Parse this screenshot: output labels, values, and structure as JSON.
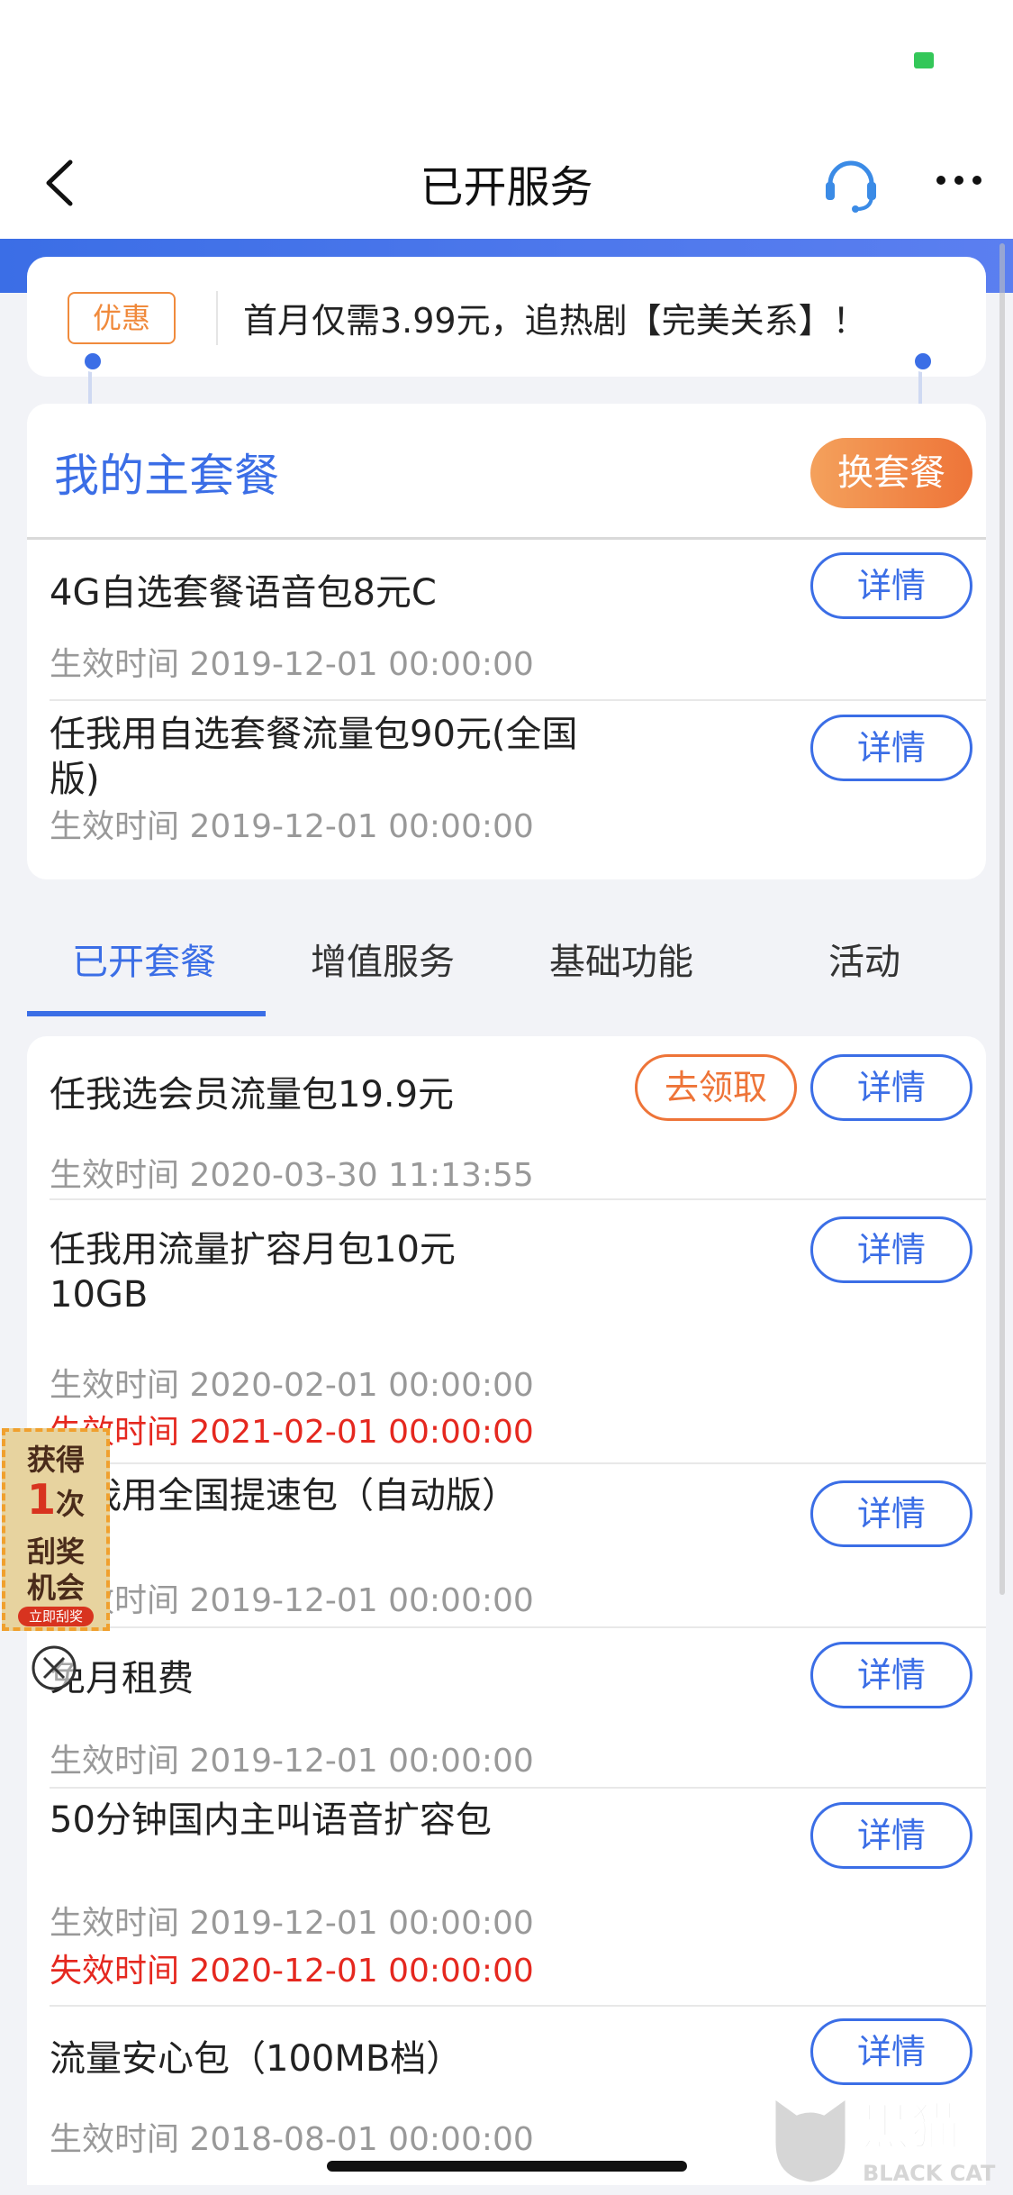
{
  "nav": {
    "title": "已开服务"
  },
  "promo": {
    "tag": "优惠",
    "text": "首月仅需3.99元，追热剧【完美关系】！"
  },
  "main_package": {
    "title": "我的主套餐",
    "switch_label": "换套餐",
    "items": [
      {
        "name": "4G自选套餐语音包8元C",
        "date": "生效时间 2019-12-01  00:00:00",
        "detail_label": "详情"
      },
      {
        "name": "任我用自选套餐流量包90元(全国版)",
        "date": "生效时间 2019-12-01  00:00:00",
        "detail_label": "详情"
      }
    ]
  },
  "tabs": [
    {
      "label": "已开套餐",
      "active": true
    },
    {
      "label": "增值服务",
      "active": false
    },
    {
      "label": "基础功能",
      "active": false
    },
    {
      "label": "活动",
      "active": false
    }
  ],
  "services": [
    {
      "name": "任我选会员流量包19.9元",
      "date": "生效时间 2020-03-30  11:13:55",
      "claim_label": "去领取",
      "detail_label": "详情"
    },
    {
      "name": "任我用流量扩容月包10元10GB",
      "date": "生效时间 2020-02-01  00:00:00",
      "expire": "失效时间 2021-02-01  00:00:00",
      "detail_label": "详情"
    },
    {
      "name": "任我用全国提速包（自动版）",
      "date": "生效时间 2019-12-01  00:00:00",
      "detail_label": "详情"
    },
    {
      "name": "免月租费",
      "date": "生效时间 2019-12-01  00:00:00",
      "detail_label": "详情"
    },
    {
      "name": "50分钟国内主叫语音扩容包",
      "date": "生效时间 2019-12-01  00:00:00",
      "expire": "失效时间 2020-12-01  00:00:00",
      "detail_label": "详情"
    },
    {
      "name": "流量安心包（100MB档）",
      "date": "生效时间 2018-08-01  00:00:00",
      "detail_label": "详情"
    }
  ],
  "scratch_float": {
    "line1": "获得",
    "count": "1",
    "line2": "次",
    "line3": "刮奖",
    "line4": "机会",
    "button": "立即刮奖"
  },
  "watermark": {
    "cn": "黑猫",
    "en": "BLACK CAT"
  },
  "colors": {
    "accent": "#3b6ee6",
    "orange": "#ee7438",
    "expire_red": "#e5281f"
  }
}
